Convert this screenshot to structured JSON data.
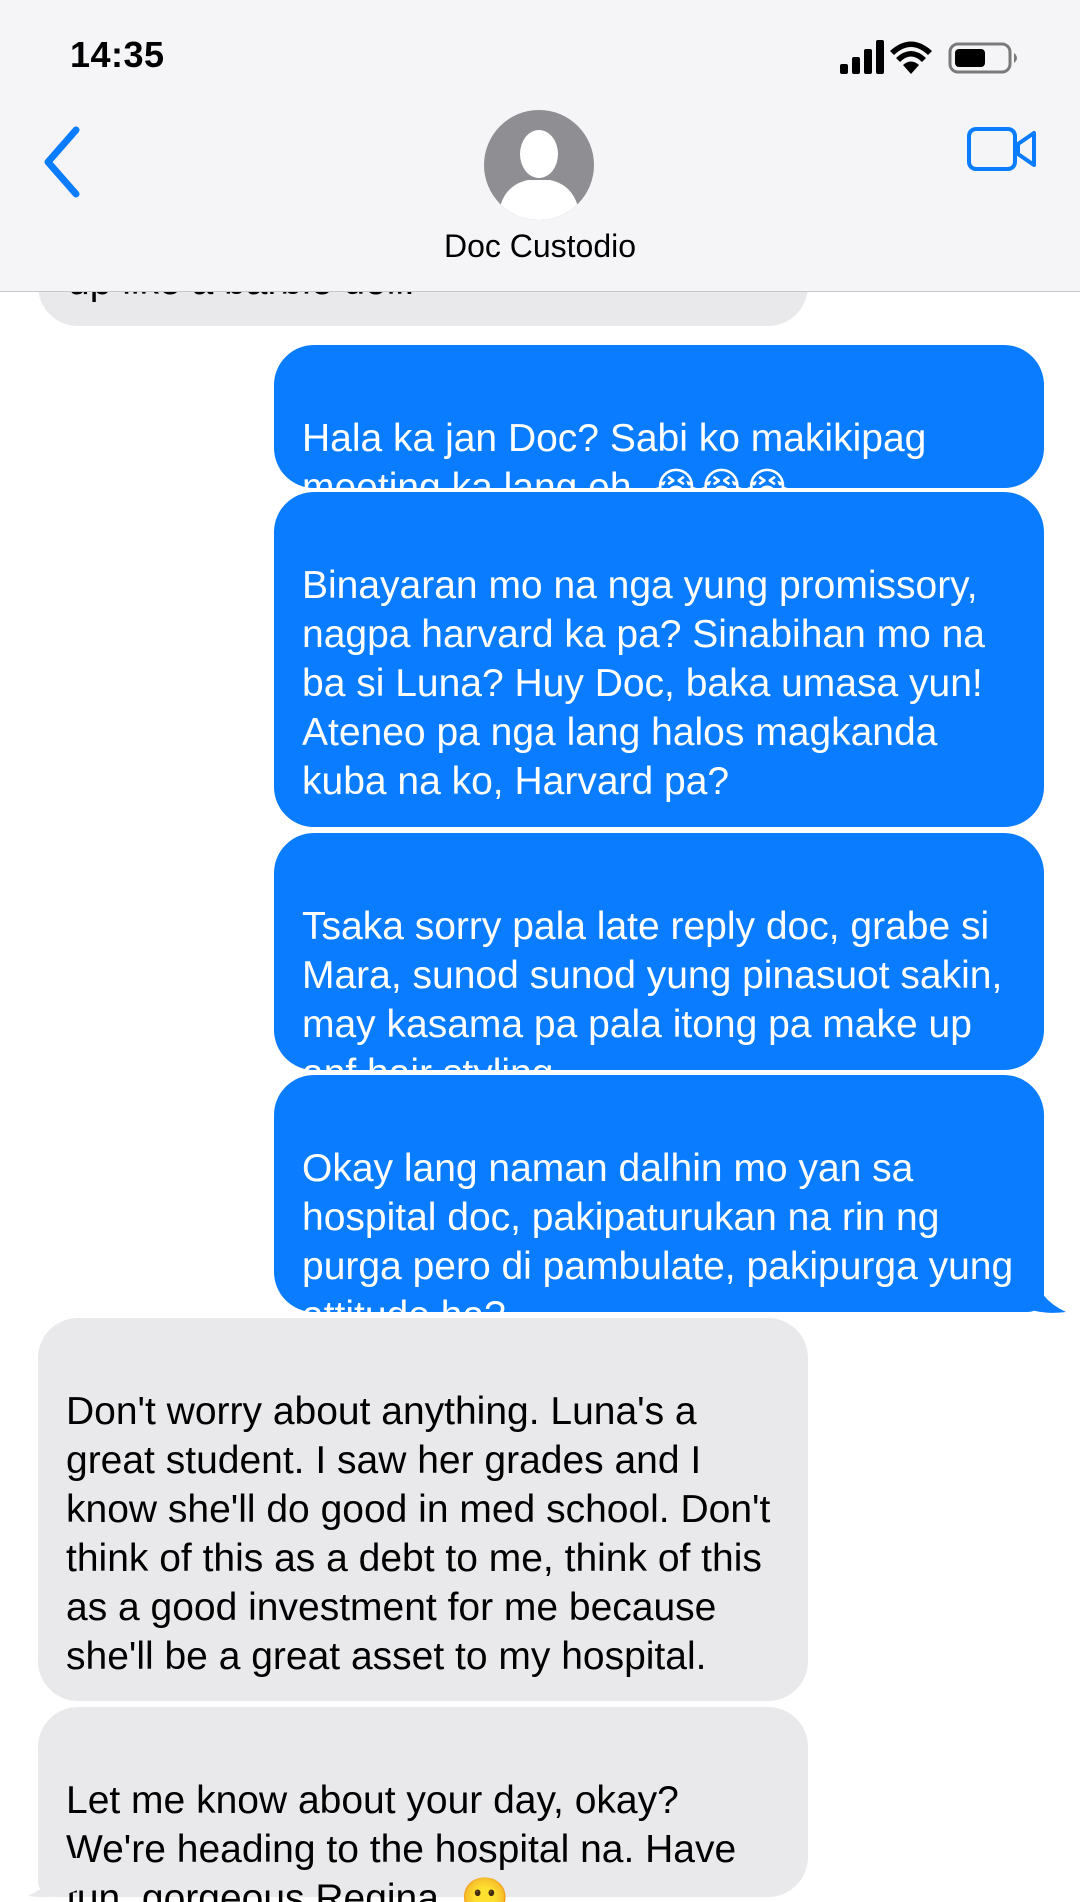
{
  "status_bar": {
    "time": "14:35",
    "icons": [
      "cellular-signal-icon",
      "wifi-icon",
      "battery-icon"
    ]
  },
  "nav": {
    "contact_name": "Doc Custodio",
    "back_icon": "chevron-left-icon",
    "video_icon": "video-camera-icon",
    "avatar_icon": "person-silhouette-icon"
  },
  "colors": {
    "sent_bubble": "#0a7cff",
    "received_bubble": "#e9e9eb",
    "accent": "#0a7cff"
  },
  "messages": [
    {
      "direction": "received",
      "text": "up like a barbie doll."
    },
    {
      "direction": "sent",
      "text": "Hala ka jan Doc? Sabi ko makikipag meeting ka lang eh. 😭😭😭"
    },
    {
      "direction": "sent",
      "text": "Binayaran mo na nga yung promissory, nagpa harvard ka pa? Sinabihan mo na ba si Luna? Huy Doc, baka umasa yun! Ateneo pa nga lang halos magkanda kuba na ko, Harvard pa?"
    },
    {
      "direction": "sent",
      "text": "Tsaka sorry pala late reply doc, grabe si Mara, sunod sunod yung pinasuot sakin, may kasama pa pala itong pa make up anf hair styling."
    },
    {
      "direction": "sent",
      "text": "Okay lang naman dalhin mo yan sa hospital doc, pakipaturukan na rin ng purga pero di pambulate, pakipurga yung attitude ha?"
    },
    {
      "direction": "received",
      "text": "Don't worry about anything. Luna's a great student. I saw her grades and I know she'll do good in med school. Don't think of this as a debt to me, think of this as a good investment for me because she'll be a great asset to my hospital."
    },
    {
      "direction": "received",
      "text": "Let me know about your day, okay? We're heading to the hospital na. Have fun, gorgeous Regina. 🙂"
    }
  ]
}
